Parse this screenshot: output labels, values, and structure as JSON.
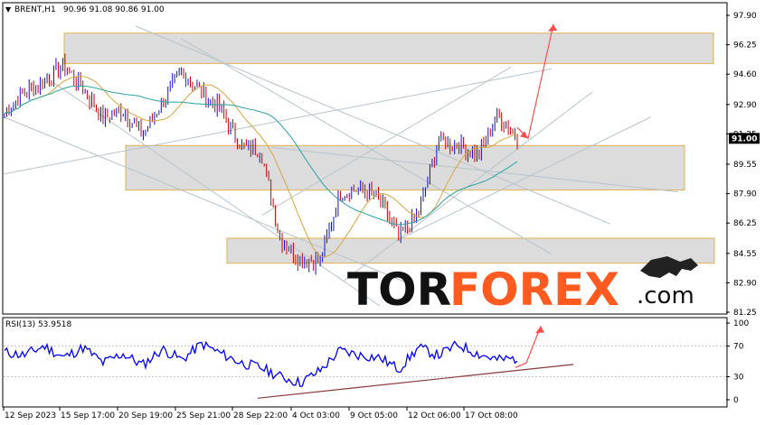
{
  "header": {
    "symbol": "BRENT,H1",
    "ohlc": "90.96 91.08 90.86 91.00"
  },
  "price_axis_labels": [
    "97.90",
    "96.25",
    "94.60",
    "92.90",
    "91.25",
    "89.55",
    "87.90",
    "86.25",
    "84.55",
    "82.90",
    "81.25"
  ],
  "current_price_label": "91.00",
  "rsi": {
    "label": "RSI(13) 53.9518",
    "axis_labels": [
      "100",
      "70",
      "30",
      "0"
    ]
  },
  "time_axis_labels": [
    "12 Sep 2023",
    "15 Sep 17:00",
    "20 Sep 19:00",
    "25 Sep 21:00",
    "28 Sep 22:00",
    "4 Oct 03:00",
    "9 Oct 05:00",
    "12 Oct 06:00",
    "17 Oct 08:00"
  ],
  "logo": {
    "part1": "TOR",
    "part2": "FOREX",
    "part3": ".com"
  },
  "colors": {
    "candle_up": "#1010e0",
    "candle_down": "#cc0000",
    "ma_fast": "#d9a441",
    "ma_slow": "#2aa3a3",
    "zone_fill": "#dcdcdc",
    "zone_border": "#e0b050",
    "trendline": "#b8c4cc",
    "forecast_arrow": "#ff4d4d",
    "rsi_line": "#0000ff",
    "rsi_support": "#8b3a3a",
    "price_tag": "#000000",
    "logo_dark": "#111111",
    "logo_orange": "#ff5a1f"
  },
  "chart_data": {
    "type": "candlestick",
    "instrument": "BRENT",
    "timeframe": "H1",
    "ylim": [
      81.25,
      97.9
    ],
    "last_price": 91.0,
    "close_path": [
      {
        "x": "12 Sep 2023",
        "y": 92.4
      },
      {
        "x": "13 Sep",
        "y": 93.6
      },
      {
        "x": "14 Sep",
        "y": 94.2
      },
      {
        "x": "15 Sep 17:00",
        "y": 95.1
      },
      {
        "x": "18 Sep",
        "y": 93.8
      },
      {
        "x": "19 Sep",
        "y": 92.1
      },
      {
        "x": "20 Sep 19:00",
        "y": 92.6
      },
      {
        "x": "21 Sep",
        "y": 91.2
      },
      {
        "x": "22 Sep",
        "y": 93.1
      },
      {
        "x": "25 Sep 21:00",
        "y": 94.7
      },
      {
        "x": "26 Sep",
        "y": 93.6
      },
      {
        "x": "27 Sep",
        "y": 92.5
      },
      {
        "x": "28 Sep 22:00",
        "y": 90.6
      },
      {
        "x": "2 Oct",
        "y": 90.3
      },
      {
        "x": "3 Oct",
        "y": 85.3
      },
      {
        "x": "4 Oct 03:00",
        "y": 84.2
      },
      {
        "x": "5 Oct",
        "y": 84.1
      },
      {
        "x": "6 Oct",
        "y": 87.9
      },
      {
        "x": "9 Oct 05:00",
        "y": 88.2
      },
      {
        "x": "10 Oct",
        "y": 87.6
      },
      {
        "x": "11 Oct",
        "y": 85.4
      },
      {
        "x": "12 Oct 06:00",
        "y": 86.8
      },
      {
        "x": "13 Oct",
        "y": 90.9
      },
      {
        "x": "16 Oct",
        "y": 90.6
      },
      {
        "x": "17 Oct 08:00",
        "y": 90.1
      },
      {
        "x": "18 Oct",
        "y": 92.3
      },
      {
        "x": "19 Oct",
        "y": 91.0
      }
    ],
    "zones": [
      {
        "from": 95.2,
        "to": 96.9
      },
      {
        "from": 88.1,
        "to": 90.6
      },
      {
        "from": 84.0,
        "to": 85.4
      }
    ],
    "forecast": {
      "from": 91.0,
      "to": 97.4
    },
    "rsi": {
      "period": 13,
      "value": 53.9518,
      "ylim": [
        0,
        100
      ],
      "levels": [
        30,
        70
      ],
      "path": [
        62,
        58,
        70,
        55,
        68,
        48,
        60,
        45,
        66,
        52,
        73,
        60,
        48,
        42,
        30,
        22,
        38,
        64,
        58,
        55,
        40,
        68,
        58,
        72,
        60,
        52,
        54
      ]
    }
  }
}
